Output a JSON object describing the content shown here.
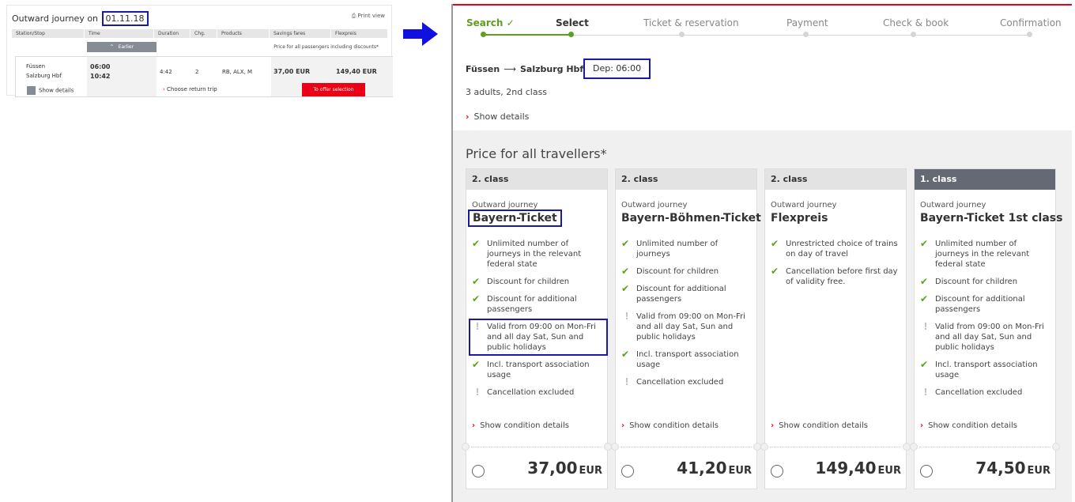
{
  "left_screenshot": {
    "title_prefix": "Outward journey on",
    "date": "01.11.18",
    "print_label": "Print view",
    "columns": [
      "Station/Stop",
      "Time",
      "Duration",
      "Chg.",
      "Products",
      "Savings fares",
      "Flexpreis"
    ],
    "earlier_label": "Earlier",
    "note": "Price for all passengers including discounts*",
    "row": {
      "from": "Füssen",
      "to": "Salzburg Hbf",
      "dep": "06:00",
      "arr": "10:42",
      "duration": "4:42",
      "changes": "2",
      "products": "RB, ALX, M",
      "savings_price": "37,00 EUR",
      "flex_price": "149,40 EUR",
      "show_details": "Show details",
      "return_trip": "Choose return trip",
      "offer_button": "To offer selection"
    }
  },
  "steps": [
    {
      "label": "Search ✓",
      "state": "done"
    },
    {
      "label": "Select",
      "state": "current"
    },
    {
      "label": "Ticket & reservation",
      "state": "todo"
    },
    {
      "label": "Payment",
      "state": "todo"
    },
    {
      "label": "Check & book",
      "state": "todo"
    },
    {
      "label": "Confirmation",
      "state": "todo"
    }
  ],
  "journey": {
    "from": "Füssen",
    "to": "Salzburg Hbf",
    "dep_label": "Dep: 06:00",
    "passengers": "3 adults, 2nd class",
    "show_details": "Show details"
  },
  "price_title": "Price for all travellers*",
  "cards": [
    {
      "class": "2. class",
      "subtitle": "Outward journey",
      "name": "Bayern-Ticket",
      "features": [
        {
          "type": "ok",
          "text": "Unlimited number of journeys in the relevant federal state"
        },
        {
          "type": "ok",
          "text": "Discount for children"
        },
        {
          "type": "ok",
          "text": "Discount for additional passengers"
        },
        {
          "type": "warn",
          "text": "Valid from 09:00 on Mon-Fri and all day Sat, Sun and public holidays"
        },
        {
          "type": "ok",
          "text": "Incl. transport association usage"
        },
        {
          "type": "warn",
          "text": "Cancellation excluded"
        }
      ],
      "condition_label": "Show condition details",
      "price": "37,00",
      "currency": "EUR"
    },
    {
      "class": "2. class",
      "subtitle": "Outward journey",
      "name": "Bayern-Böhmen-Ticket",
      "features": [
        {
          "type": "ok",
          "text": "Unlimited number of journeys"
        },
        {
          "type": "ok",
          "text": "Discount for children"
        },
        {
          "type": "ok",
          "text": "Discount for additional passengers"
        },
        {
          "type": "warn",
          "text": "Valid from 09:00 on Mon-Fri and all day Sat, Sun and public holidays"
        },
        {
          "type": "ok",
          "text": "Incl. transport association usage"
        },
        {
          "type": "warn",
          "text": "Cancellation excluded"
        }
      ],
      "condition_label": "Show condition details",
      "price": "41,20",
      "currency": "EUR"
    },
    {
      "class": "2. class",
      "subtitle": "Outward journey",
      "name": "Flexpreis",
      "features": [
        {
          "type": "ok",
          "text": "Unrestricted choice of trains on day of travel"
        },
        {
          "type": "ok",
          "text": "Cancellation before first day of validity free."
        }
      ],
      "condition_label": "Show condition details",
      "price": "149,40",
      "currency": "EUR"
    },
    {
      "class": "1. class",
      "subtitle": "Outward journey",
      "name": "Bayern-Ticket 1st class",
      "features": [
        {
          "type": "ok",
          "text": "Unlimited number of journeys in the relevant federal state"
        },
        {
          "type": "ok",
          "text": "Discount for children"
        },
        {
          "type": "ok",
          "text": "Discount for additional passengers"
        },
        {
          "type": "warn",
          "text": "Valid from 09:00 on Mon-Fri and all day Sat, Sun and public holidays"
        },
        {
          "type": "ok",
          "text": "Incl. transport association usage"
        },
        {
          "type": "warn",
          "text": "Cancellation excluded"
        }
      ],
      "condition_label": "Show condition details",
      "price": "74,50",
      "currency": "EUR"
    }
  ],
  "colors": {
    "accent_red": "#ec0016",
    "check_green": "#5ca01e",
    "highlight_box": "#1a1aa6",
    "first_class_head": "#646973"
  }
}
